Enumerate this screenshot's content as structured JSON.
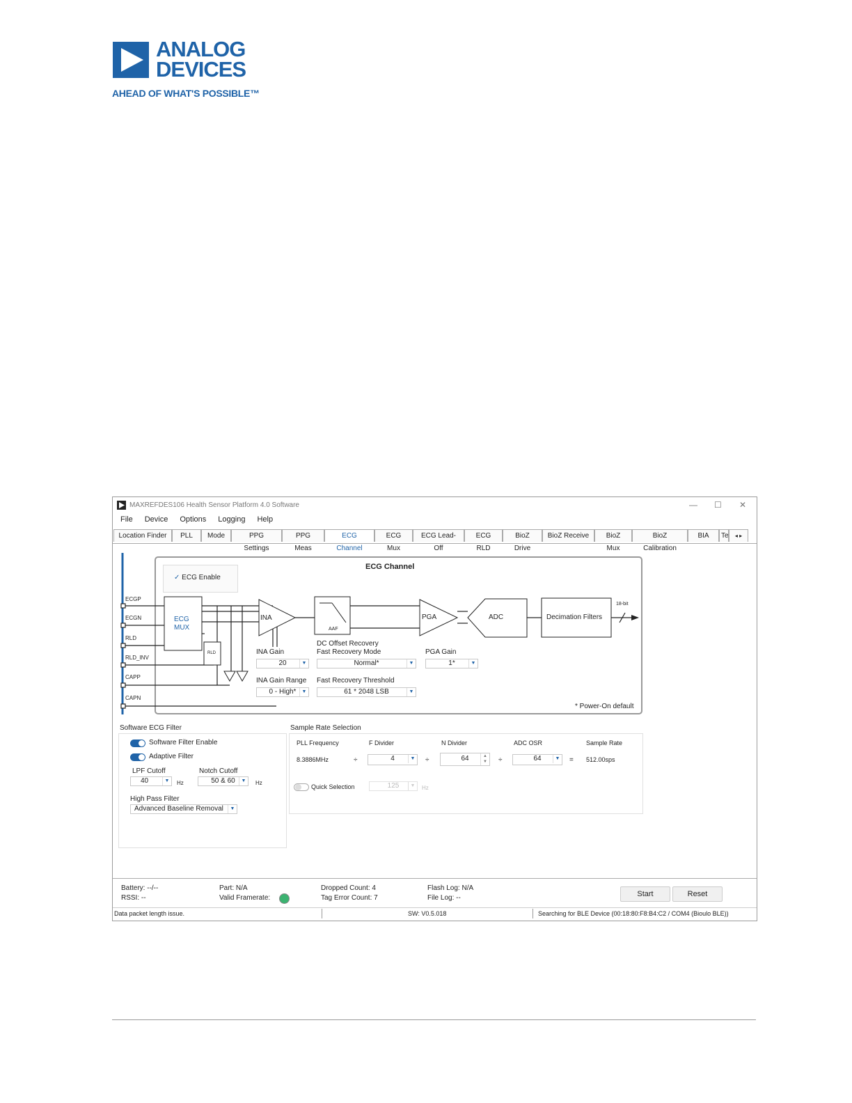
{
  "logo": {
    "line1": "ANALOG",
    "line2": "DEVICES",
    "tagline": "AHEAD OF WHAT'S POSSIBLE™"
  },
  "window": {
    "title": "MAXREFDES106 Health Sensor Platform 4.0 Software",
    "controls": [
      "—",
      "☐",
      "✕"
    ]
  },
  "menu": [
    "File",
    "Device",
    "Options",
    "Logging",
    "Help"
  ],
  "tabs": [
    "Location Finder",
    "PLL",
    "Mode",
    "PPG Settings",
    "PPG Meas",
    "ECG Channel",
    "ECG Mux",
    "ECG Lead-Off",
    "ECG RLD",
    "BioZ Drive",
    "BioZ Receive",
    "BioZ Mux",
    "BioZ Calibration",
    "BIA",
    "Te"
  ],
  "active_tab": "ECG Channel",
  "diagram": {
    "title": "ECG Channel",
    "enable_label": "ECG Enable",
    "pins": [
      "ECGP",
      "ECGN",
      "RLD",
      "RLD_INV",
      "CAPP",
      "CAPN"
    ],
    "mux": "ECG MUX",
    "rld": "RLD",
    "ina": "INA",
    "aaf": "AAF",
    "pga": "PGA",
    "adc": "ADC",
    "decim": "Decimation Filters",
    "bits": "18-bit",
    "ina_gain_label": "INA Gain",
    "ina_gain": "20",
    "ina_range_label": "INA Gain Range",
    "ina_range": "0 - High*",
    "dc_label1": "DC Offset Recovery",
    "dc_label2": "Fast Recovery Mode",
    "dc_mode": "Normal*",
    "thresh_label": "Fast Recovery Threshold",
    "thresh": "61 * 2048 LSB",
    "pga_gain_label": "PGA Gain",
    "pga_gain": "1*",
    "note": "* Power-On default"
  },
  "sw_filter": {
    "group": "Software ECG Filter",
    "enable": "Software Filter Enable",
    "adaptive": "Adaptive Filter",
    "lpf_label": "LPF Cutoff",
    "lpf": "40",
    "unit": "Hz",
    "notch_label": "Notch Cutoff",
    "notch": "50 & 60",
    "hpf_label": "High Pass Filter",
    "hpf": "Advanced Baseline Removal"
  },
  "sample_rate": {
    "group": "Sample Rate Selection",
    "pll_label": "PLL Frequency",
    "pll": "8.3886MHz",
    "fdiv_label": "F Divider",
    "fdiv": "4",
    "ndiv_label": "N Divider",
    "ndiv": "64",
    "osr_label": "ADC OSR",
    "osr": "64",
    "rate_label": "Sample Rate",
    "rate": "512.00sps",
    "div": "÷",
    "eq": "=",
    "quick_label": "Quick Selection",
    "quick": "125",
    "unit": "Hz"
  },
  "status": {
    "battery": "Battery: --/--",
    "rssi": "RSSI: --",
    "part": "Part: N/A",
    "framerate": "Valid Framerate:",
    "dropped": "Dropped Count: 4",
    "tagerr": "Tag Error Count: 7",
    "flash": "Flash Log: N/A",
    "filelog": "File Log: --",
    "start": "Start",
    "reset": "Reset",
    "msg": "Data packet length issue.",
    "sw": "SW: V0.5.018",
    "search": "Searching for BLE Device (00:18:80:F8:B4:C2 / COM4 (Bioulo BLE))"
  },
  "colors": {
    "accent": "#1f63a8",
    "led": "#3cb371"
  }
}
